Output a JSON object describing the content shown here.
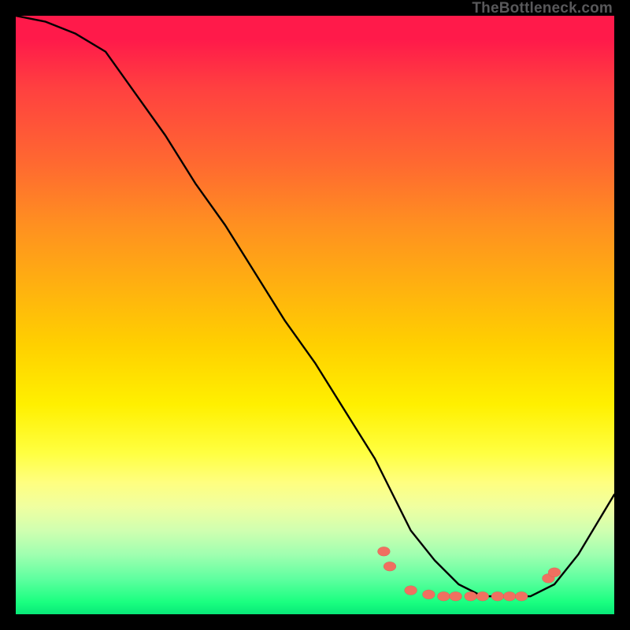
{
  "attribution": "TheBottleneck.com",
  "chart_data": {
    "type": "line",
    "title": "",
    "xlabel": "",
    "ylabel": "",
    "xlim": [
      0,
      100
    ],
    "ylim": [
      0,
      100
    ],
    "grid": false,
    "legend": false,
    "background": "rainbow-gradient-vertical",
    "series": [
      {
        "name": "curve",
        "x": [
          0,
          5,
          10,
          15,
          20,
          25,
          30,
          35,
          40,
          45,
          50,
          55,
          60,
          63,
          66,
          70,
          74,
          78,
          82,
          86,
          90,
          94,
          100
        ],
        "values": [
          100,
          99,
          97,
          94,
          87,
          80,
          72,
          65,
          57,
          49,
          42,
          34,
          26,
          20,
          14,
          9,
          5,
          3,
          3,
          3,
          5,
          10,
          20
        ]
      }
    ],
    "markers": [
      {
        "x": 61.5,
        "y": 10.5
      },
      {
        "x": 62.5,
        "y": 8.0
      },
      {
        "x": 66.0,
        "y": 4.0
      },
      {
        "x": 69.0,
        "y": 3.3
      },
      {
        "x": 71.5,
        "y": 3.0
      },
      {
        "x": 73.5,
        "y": 3.0
      },
      {
        "x": 76.0,
        "y": 3.0
      },
      {
        "x": 78.0,
        "y": 3.0
      },
      {
        "x": 80.5,
        "y": 3.0
      },
      {
        "x": 82.5,
        "y": 3.0
      },
      {
        "x": 84.5,
        "y": 3.0
      },
      {
        "x": 89.0,
        "y": 6.0
      },
      {
        "x": 90.0,
        "y": 7.0
      }
    ]
  }
}
